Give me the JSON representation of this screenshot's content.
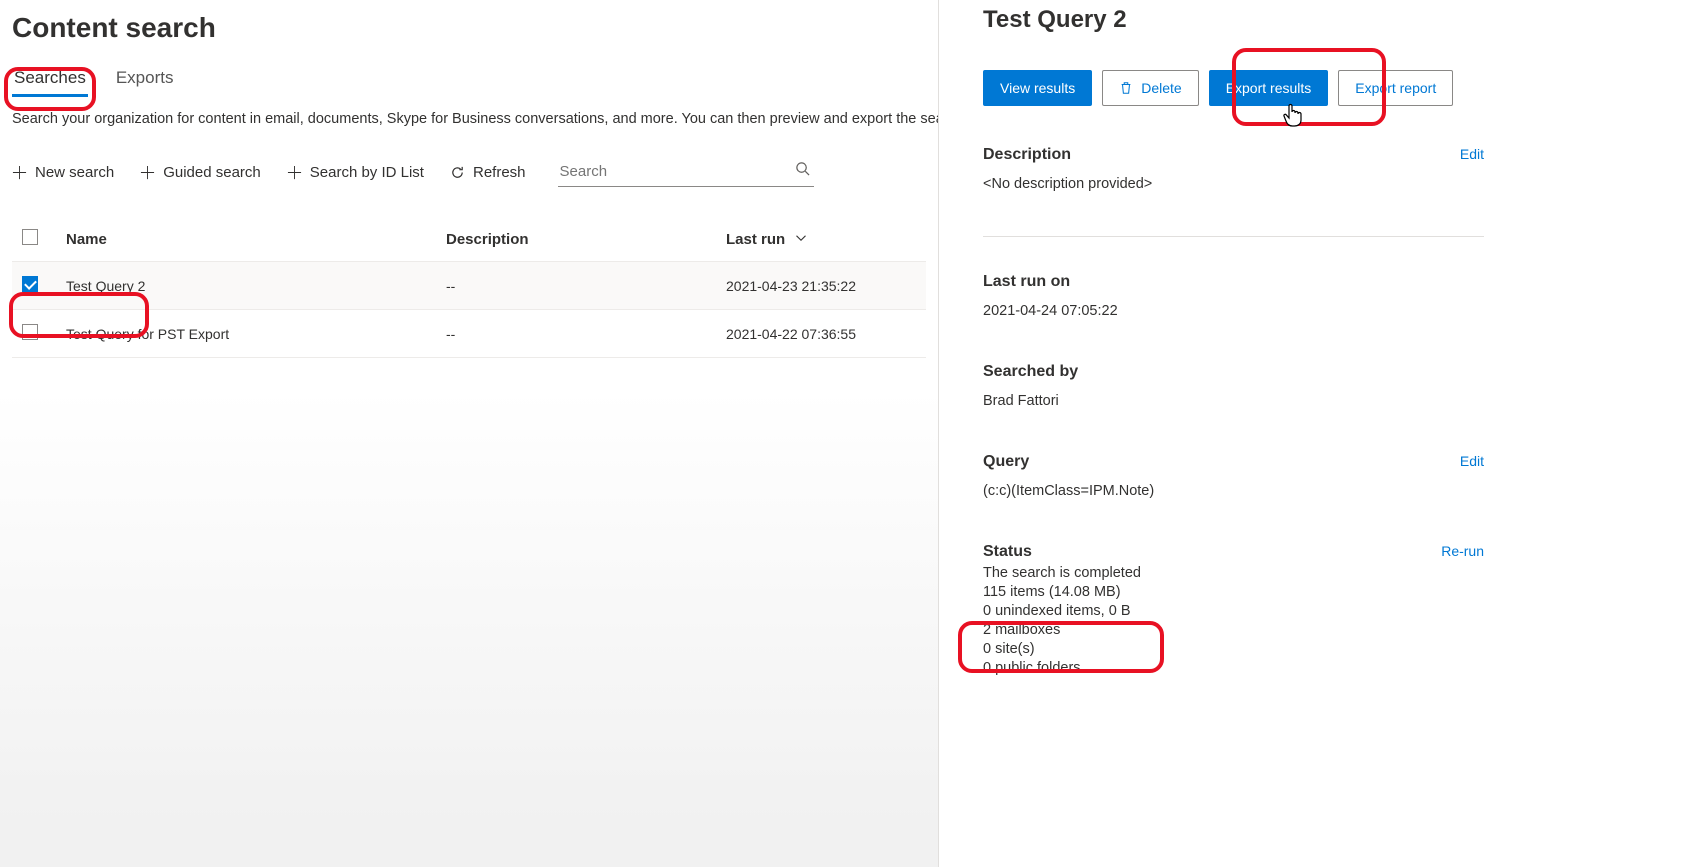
{
  "page": {
    "title": "Content search",
    "description": "Search your organization for content in email, documents, Skype for Business conversations, and more. You can then preview and export the sear"
  },
  "tabs": [
    {
      "label": "Searches",
      "active": true
    },
    {
      "label": "Exports",
      "active": false
    }
  ],
  "toolbar": {
    "new_search": "New search",
    "guided_search": "Guided search",
    "search_by_id": "Search by ID List",
    "refresh": "Refresh",
    "search_placeholder": "Search"
  },
  "columns": {
    "name": "Name",
    "description": "Description",
    "last_run": "Last run"
  },
  "rows": [
    {
      "checked": true,
      "name": "Test Query 2",
      "description": "--",
      "last_run": "2021-04-23 21:35:22"
    },
    {
      "checked": false,
      "name": "Test Query for PST Export",
      "description": "--",
      "last_run": "2021-04-22 07:36:55"
    }
  ],
  "details": {
    "title": "Test Query 2",
    "actions": {
      "view_results": "View results",
      "delete": "Delete",
      "export_results": "Export results",
      "export_report": "Export report"
    },
    "description_heading": "Description",
    "description_value": "<No description provided>",
    "description_edit": "Edit",
    "last_run_heading": "Last run on",
    "last_run_value": "2021-04-24 07:05:22",
    "searched_by_heading": "Searched by",
    "searched_by_value": "Brad Fattori",
    "query_heading": "Query",
    "query_value": "(c:c)(ItemClass=IPM.Note)",
    "query_edit": "Edit",
    "status_heading": "Status",
    "status_rerun": "Re-run",
    "status_lines": [
      "The search is completed",
      "115 items (14.08 MB)",
      "0 unindexed items, 0 B",
      "2 mailboxes",
      "0 site(s)",
      "0 public folders"
    ]
  }
}
